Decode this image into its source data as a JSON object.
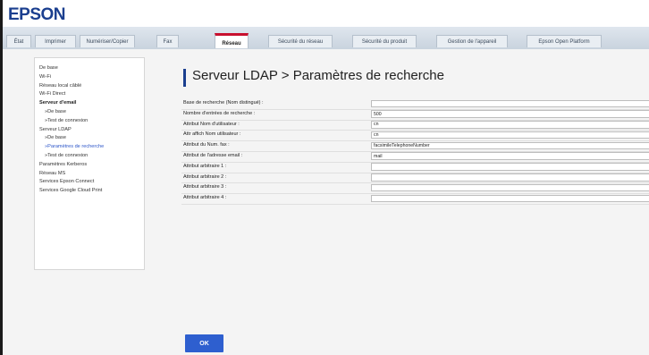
{
  "brand": {
    "logo_text": "EPSON"
  },
  "tabs": [
    {
      "label": "État"
    },
    {
      "label": "Imprimer"
    },
    {
      "label": "Numériser/Copier"
    },
    {
      "label": "Fax"
    },
    {
      "label": "Réseau",
      "active": true
    },
    {
      "label": "Sécurité du réseau"
    },
    {
      "label": "Sécurité du produit"
    },
    {
      "label": "Gestion de l'appareil"
    },
    {
      "label": "Epson Open Platform"
    }
  ],
  "sidebar": {
    "items": [
      {
        "label": "De base"
      },
      {
        "label": "Wi-Fi"
      },
      {
        "label": "Réseau local câblé"
      },
      {
        "label": "Wi-Fi Direct"
      },
      {
        "label": "Serveur d'email"
      },
      {
        "label": "»De base"
      },
      {
        "label": "»Test de connexion"
      },
      {
        "label": "Serveur LDAP"
      },
      {
        "label": "»De base"
      },
      {
        "label": "»Paramètres de recherche"
      },
      {
        "label": "»Test de connexion"
      },
      {
        "label": "Paramètres Kerberos"
      },
      {
        "label": "Réseau MS"
      },
      {
        "label": "Services Epson Connect"
      },
      {
        "label": "Services Google Cloud Print"
      }
    ]
  },
  "main": {
    "title": "Serveur LDAP > Paramètres de recherche",
    "fields": [
      {
        "label": "Base de recherche (Nom distingué) :",
        "value": ""
      },
      {
        "label": "Nombre d'entrées de recherche :",
        "value": "500"
      },
      {
        "label": "Attribut Nom d'utilisateur :",
        "value": "cn"
      },
      {
        "label": "Attr affich Nom utilisateur :",
        "value": "cn"
      },
      {
        "label": "Attribut du Num. fax :",
        "value": "facsimileTelephoneNumber"
      },
      {
        "label": "Attribut de l'adresse email :",
        "value": "mail"
      },
      {
        "label": "Attribut arbitraire 1 :",
        "value": ""
      },
      {
        "label": "Attribut arbitraire 2 :",
        "value": ""
      },
      {
        "label": "Attribut arbitraire 3 :",
        "value": ""
      },
      {
        "label": "Attribut arbitraire 4 :",
        "value": ""
      }
    ],
    "ok_label": "OK"
  },
  "colors": {
    "brand": "#1b3f8f",
    "active_tab_marker": "#c8102e",
    "current_link": "#2d56c9",
    "ok_button": "#2e5fcf"
  }
}
